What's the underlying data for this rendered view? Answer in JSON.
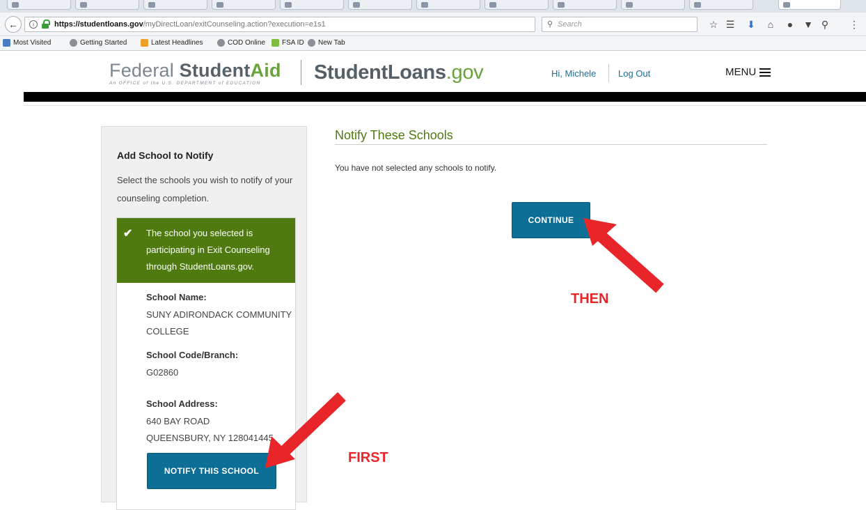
{
  "browser": {
    "url_host": "https://studentloans.gov",
    "url_path": "/myDirectLoan/exitCounseling.action?execution=e1s1",
    "search_placeholder": "Search",
    "bookmarks": [
      {
        "label": "Most Visited",
        "icon": "most-visited-icon"
      },
      {
        "label": "Getting Started",
        "icon": "globe-icon"
      },
      {
        "label": "Latest Headlines",
        "icon": "rss-icon"
      },
      {
        "label": "COD Online",
        "icon": "globe-icon"
      },
      {
        "label": "FSA ID",
        "icon": "fsa-icon"
      },
      {
        "label": "New Tab",
        "icon": "globe-icon"
      }
    ]
  },
  "header": {
    "fsa_logo_light": "Federal",
    "fsa_logo_bold": "Student",
    "fsa_logo_green": "Aid",
    "fsa_tagline": "An OFFICE of the U.S. DEPARTMENT of EDUCATION",
    "site_name": "StudentLoans",
    "site_tld": ".gov",
    "greeting": "Hi, Michele",
    "logout": "Log Out",
    "menu": "MENU"
  },
  "sidebar": {
    "title": "Add School to Notify",
    "description": "Select the schools you wish to notify of your counseling completion.",
    "success_message": "The school you selected is participating in Exit Counseling through StudentLoans.gov.",
    "school_name_label": "School Name:",
    "school_name": "SUNY ADIRONDACK COMMUNITY COLLEGE",
    "school_code_label": "School Code/Branch:",
    "school_code": "G02860",
    "school_address_label": "School Address:",
    "school_address_line1": "640 BAY ROAD",
    "school_address_line2": "QUEENSBURY, NY 128041445",
    "notify_button": "NOTIFY THIS SCHOOL"
  },
  "main": {
    "heading": "Notify These Schools",
    "empty_message": "You have not selected any schools to notify.",
    "continue_button": "CONTINUE"
  },
  "annotations": {
    "first": "FIRST",
    "then": "THEN",
    "color": "#e8262a"
  }
}
